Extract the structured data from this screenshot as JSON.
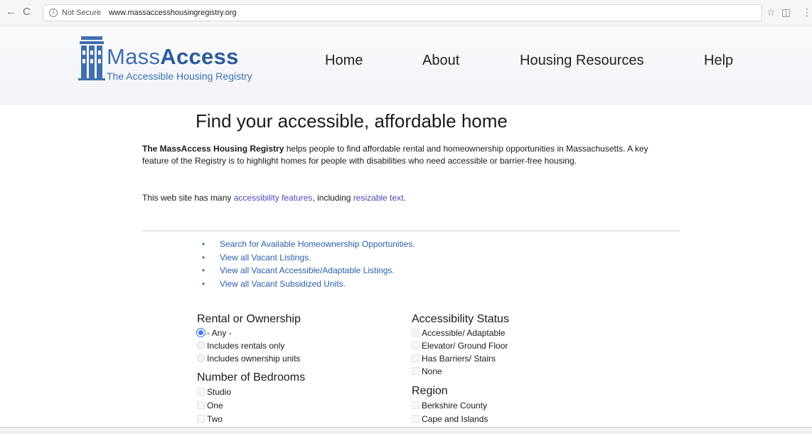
{
  "browser": {
    "nav_back": "←",
    "nav_reload": "C",
    "info_icon": "i",
    "security_label": "Not Secure",
    "url": "www.massaccesshousingregistry.org",
    "bookmark_star": "☆",
    "extension_icon": "◫",
    "menu_icon": "⋮"
  },
  "header": {
    "logo_name_part1": "Mass",
    "logo_name_part2": "Access",
    "logo_tagline": "The Accessible Housing Registry",
    "nav": {
      "home": "Home",
      "about": "About",
      "resources": "Housing Resources",
      "help": "Help"
    }
  },
  "main": {
    "title": "Find your accessible, affordable home",
    "intro_bold": "The MassAccess Housing Registry",
    "intro_rest": " helps people to find affordable rental and homeownership opportunities in Massachusetts. A key feature of the Registry is to highlight homes for people with disabilities who need accessible or barrier-free housing.",
    "access_prefix": "This web site has many ",
    "access_link1": "accessibility features",
    "access_middle": ", including ",
    "access_link2": "resizable text",
    "access_suffix": ".",
    "bullet_char": "•",
    "quick_links": [
      "Search for Available Homeownership Opportunities.",
      "View all Vacant Listings.",
      "View all Vacant Accessible/Adaptable Listings.",
      "View all Vacant Subsidized Units."
    ]
  },
  "filters": {
    "rental": {
      "heading": "Rental or Ownership",
      "options": [
        "- Any -",
        "Includes rentals only",
        "Includes ownership units"
      ],
      "selected": "- Any -"
    },
    "bedrooms": {
      "heading": "Number of Bedrooms",
      "options": [
        "Studio",
        "One",
        "Two"
      ]
    },
    "accessibility": {
      "heading": "Accessibility Status",
      "options": [
        "Accessible/ Adaptable",
        "Elevator/ Ground Floor",
        "Has Barriers/ Stairs",
        "None"
      ]
    },
    "region": {
      "heading": "Region",
      "options": [
        "Berkshire County",
        "Cape and Islands"
      ]
    }
  },
  "colors": {
    "brand_blue": "#3f6fae",
    "link_blue": "#2b5fa8",
    "link_purple": "#4a4ab8",
    "radio_selected": "#3b7ff6"
  }
}
